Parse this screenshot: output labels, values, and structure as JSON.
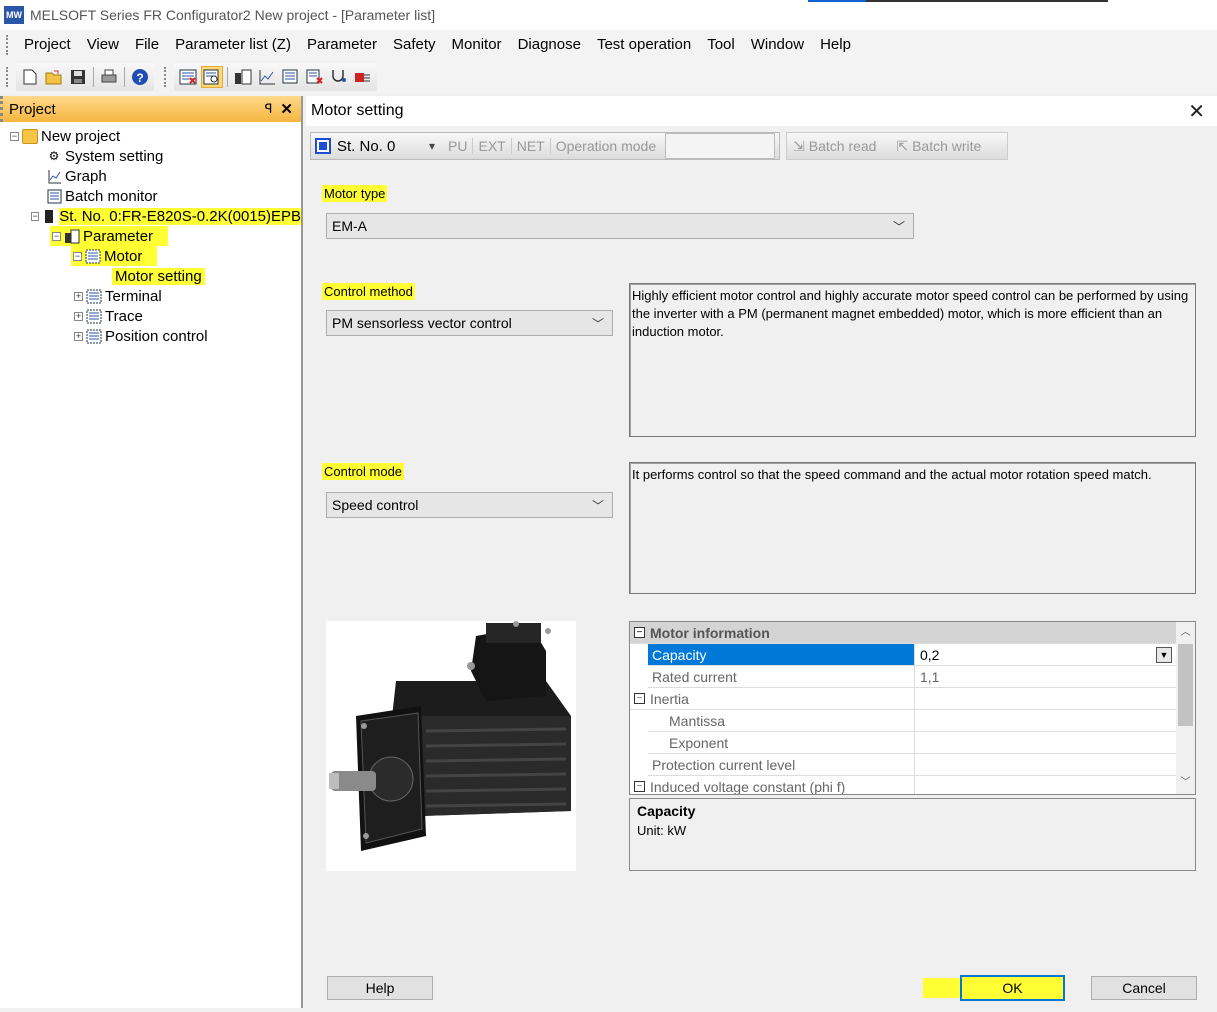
{
  "window": {
    "title": "MELSOFT Series FR Configurator2 New project - [Parameter list]",
    "icon_text": "MW"
  },
  "menu": [
    "Project",
    "View",
    "File",
    "Parameter list (Z)",
    "Parameter",
    "Safety",
    "Monitor",
    "Diagnose",
    "Test operation",
    "Tool",
    "Window",
    "Help"
  ],
  "left_panel": {
    "title": "Project",
    "pin": "ꟼ",
    "close": "✕",
    "tree": {
      "root": "New project",
      "system_setting": "System setting",
      "graph": "Graph",
      "batch_monitor": "Batch monitor",
      "station": "St. No. 0:FR-E820S-0.2K(0015)EPB",
      "parameter": "Parameter",
      "motor": "Motor",
      "motor_setting": "Motor setting",
      "terminal": "Terminal",
      "trace": "Trace",
      "position_control": "Position control"
    }
  },
  "dialog": {
    "title": "Motor setting",
    "close": "✕",
    "station": "St. No. 0",
    "modes": [
      "PU",
      "EXT",
      "NET",
      "Operation mode"
    ],
    "batch_read": "Batch read",
    "batch_write": "Batch write",
    "motor_type": {
      "label": "Motor type",
      "value": "EM-A"
    },
    "control_method": {
      "label": "Control method",
      "value": "PM sensorless vector control",
      "description": "Highly efficient motor control and highly accurate motor speed control can be performed by using the inverter with a PM (permanent magnet embedded) motor, which is more efficient than an induction motor."
    },
    "control_mode": {
      "label": "Control mode",
      "value": "Speed control",
      "description": "It performs control so that the speed command and the actual motor rotation speed match."
    },
    "grid": {
      "category": "Motor information",
      "rows": [
        {
          "name": "Capacity",
          "value": "0,2"
        },
        {
          "name": "Rated current",
          "value": "1,1"
        },
        {
          "name": "Inertia",
          "value": ""
        },
        {
          "name": "Mantissa",
          "value": ""
        },
        {
          "name": "Exponent",
          "value": ""
        },
        {
          "name": "Protection current level",
          "value": ""
        },
        {
          "name": "Induced voltage constant (phi f)",
          "value": ""
        }
      ]
    },
    "help_title": "Capacity",
    "help_unit": "Unit: kW",
    "buttons": {
      "help": "Help",
      "ok": "OK",
      "cancel": "Cancel"
    }
  }
}
